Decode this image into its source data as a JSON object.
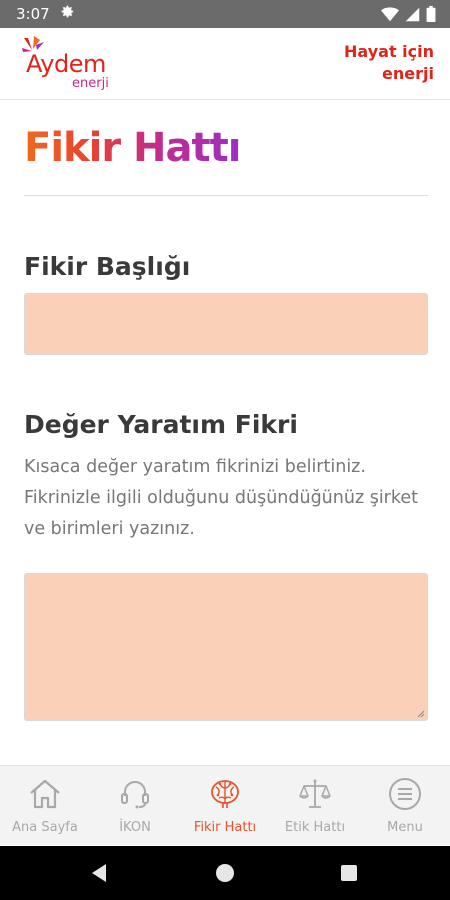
{
  "status_bar": {
    "time": "3:07",
    "icons": [
      "gear-icon",
      "wifi-icon",
      "signal-icon",
      "battery-icon"
    ]
  },
  "header": {
    "logo_text": "Aydem",
    "logo_subtext": "enerji",
    "tagline_line1": "Hayat için",
    "tagline_line2": "enerji"
  },
  "page": {
    "title": "Fikir Hattı"
  },
  "form": {
    "title_label": "Fikir Başlığı",
    "title_value": "",
    "value_label": "Değer Yaratım Fikri",
    "value_help": "Kısaca değer yaratım fikrinizi belirtiniz. Fikrinizle ilgili olduğunu düşündüğünüz şirket ve birimleri yazınız.",
    "value_value": ""
  },
  "bottom_nav": {
    "items": [
      {
        "label": "Ana Sayfa",
        "icon": "home-icon",
        "active": false
      },
      {
        "label": "İKON",
        "icon": "headset-icon",
        "active": false
      },
      {
        "label": "Fikir Hattı",
        "icon": "brain-icon",
        "active": true
      },
      {
        "label": "Etik Hattı",
        "icon": "scales-icon",
        "active": false
      },
      {
        "label": "Menu",
        "icon": "menu-icon",
        "active": false
      }
    ]
  },
  "colors": {
    "brand_red": "#e2231a",
    "input_fill": "#fad0b8",
    "active_nav": "#e8532a",
    "inactive_nav": "#a8a8a8"
  }
}
